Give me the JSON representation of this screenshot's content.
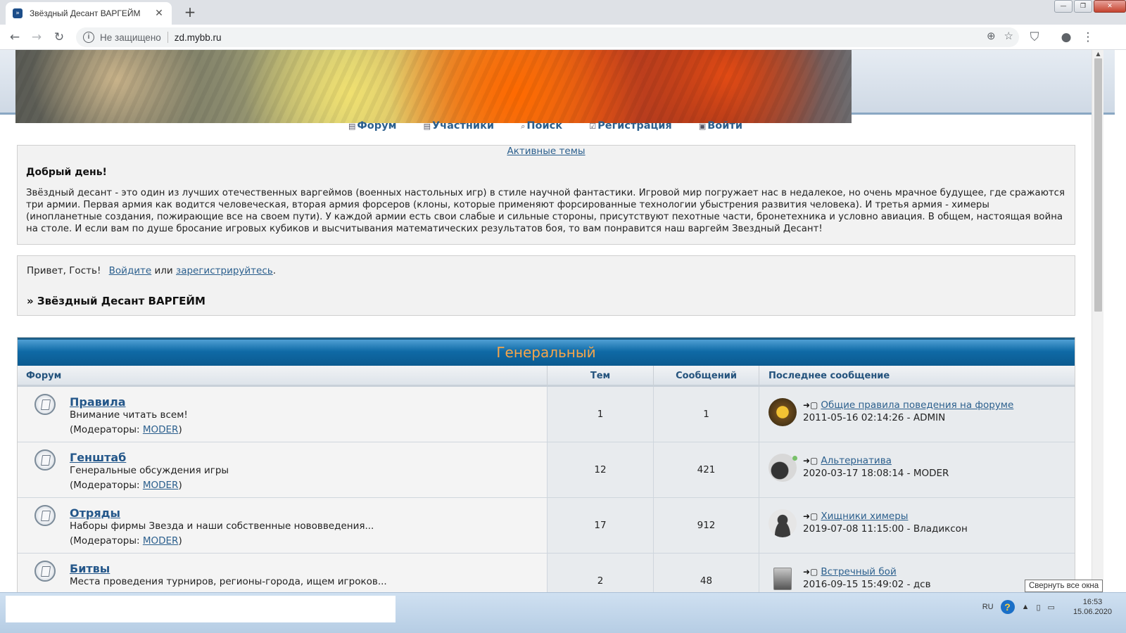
{
  "browser": {
    "tab_title": "Звёздный Десант ВАРГЕЙМ",
    "tab_close": "✕",
    "new_tab": "+",
    "insecure_label": "Не защищено",
    "url": "zd.mybb.ru",
    "win_minimize": "—",
    "win_restore": "❐",
    "win_close": "✕"
  },
  "nav": {
    "forum": "Форум",
    "members": "Участники",
    "search": "Поиск",
    "register": "Регистрация",
    "login": "Войти"
  },
  "intro": {
    "active_topics": "Активные темы",
    "title": "Добрый день!",
    "text": "Звёздный десант - это один из лучших отечественных варгеймов (военных настольных игр) в стиле научной фантастики. Игровой мир погружает нас в недалекое, но очень мрачное будущее, где сражаются три армии. Первая армия как водится человеческая, вторая армия форсеров (клоны, которые применяют форсированные технологии убыстрения развития человека). И третья армия - химеры (инопланетные создания, пожирающие все на своем пути). У каждой армии есть свои слабые и сильные стороны, присутствуют пехотные части, бронетехника и условно авиация. В общем, настоящая война на столе. И если вам по душе бросание игровых кубиков и высчитывания математических результатов боя, то вам понравится наш варгейм Звездный Десант!"
  },
  "welcome": {
    "hello": "Привет, Гость!",
    "login_link": "Войдите",
    "or": "или",
    "register_link": "зарегистрируйтесь",
    "dot": ".",
    "breadcrumb": "» Звёздный Десант ВАРГЕЙМ"
  },
  "category": {
    "title": "Генеральный",
    "col_forum": "Форум",
    "col_topics": "Тем",
    "col_posts": "Сообщений",
    "col_last": "Последнее сообщение",
    "mods_prefix": "(Модераторы: ",
    "mods_suffix": ")",
    "forums": [
      {
        "name": "Правила",
        "desc": "Внимание читать всем!",
        "moderator": "MODER",
        "topics": "1",
        "posts": "1",
        "last_title": "Общие правила поведения на форуме",
        "last_meta": "2011-05-16 02:14:26 - ADMIN"
      },
      {
        "name": "Генштаб",
        "desc": "Генеральные обсуждения игры",
        "moderator": "MODER",
        "topics": "12",
        "posts": "421",
        "last_title": "Альтернатива",
        "last_meta": "2020-03-17 18:08:14 - MODER"
      },
      {
        "name": "Отряды",
        "desc": "Наборы фирмы Звезда и наши собственные нововведения...",
        "moderator": "MODER",
        "topics": "17",
        "posts": "912",
        "last_title": "Хищники химеры",
        "last_meta": "2019-07-08 11:15:00 - Владиксон"
      },
      {
        "name": "Битвы",
        "desc": "Места проведения турниров, регионы-города, ищем игроков...",
        "moderator": "",
        "topics": "2",
        "posts": "48",
        "last_title": "Встречный бой",
        "last_meta": "2016-09-15 15:49:02 - дсв"
      }
    ]
  },
  "system": {
    "tooltip": "Свернуть все окна",
    "lang": "RU",
    "time": "16:53",
    "date": "15.06.2020"
  }
}
